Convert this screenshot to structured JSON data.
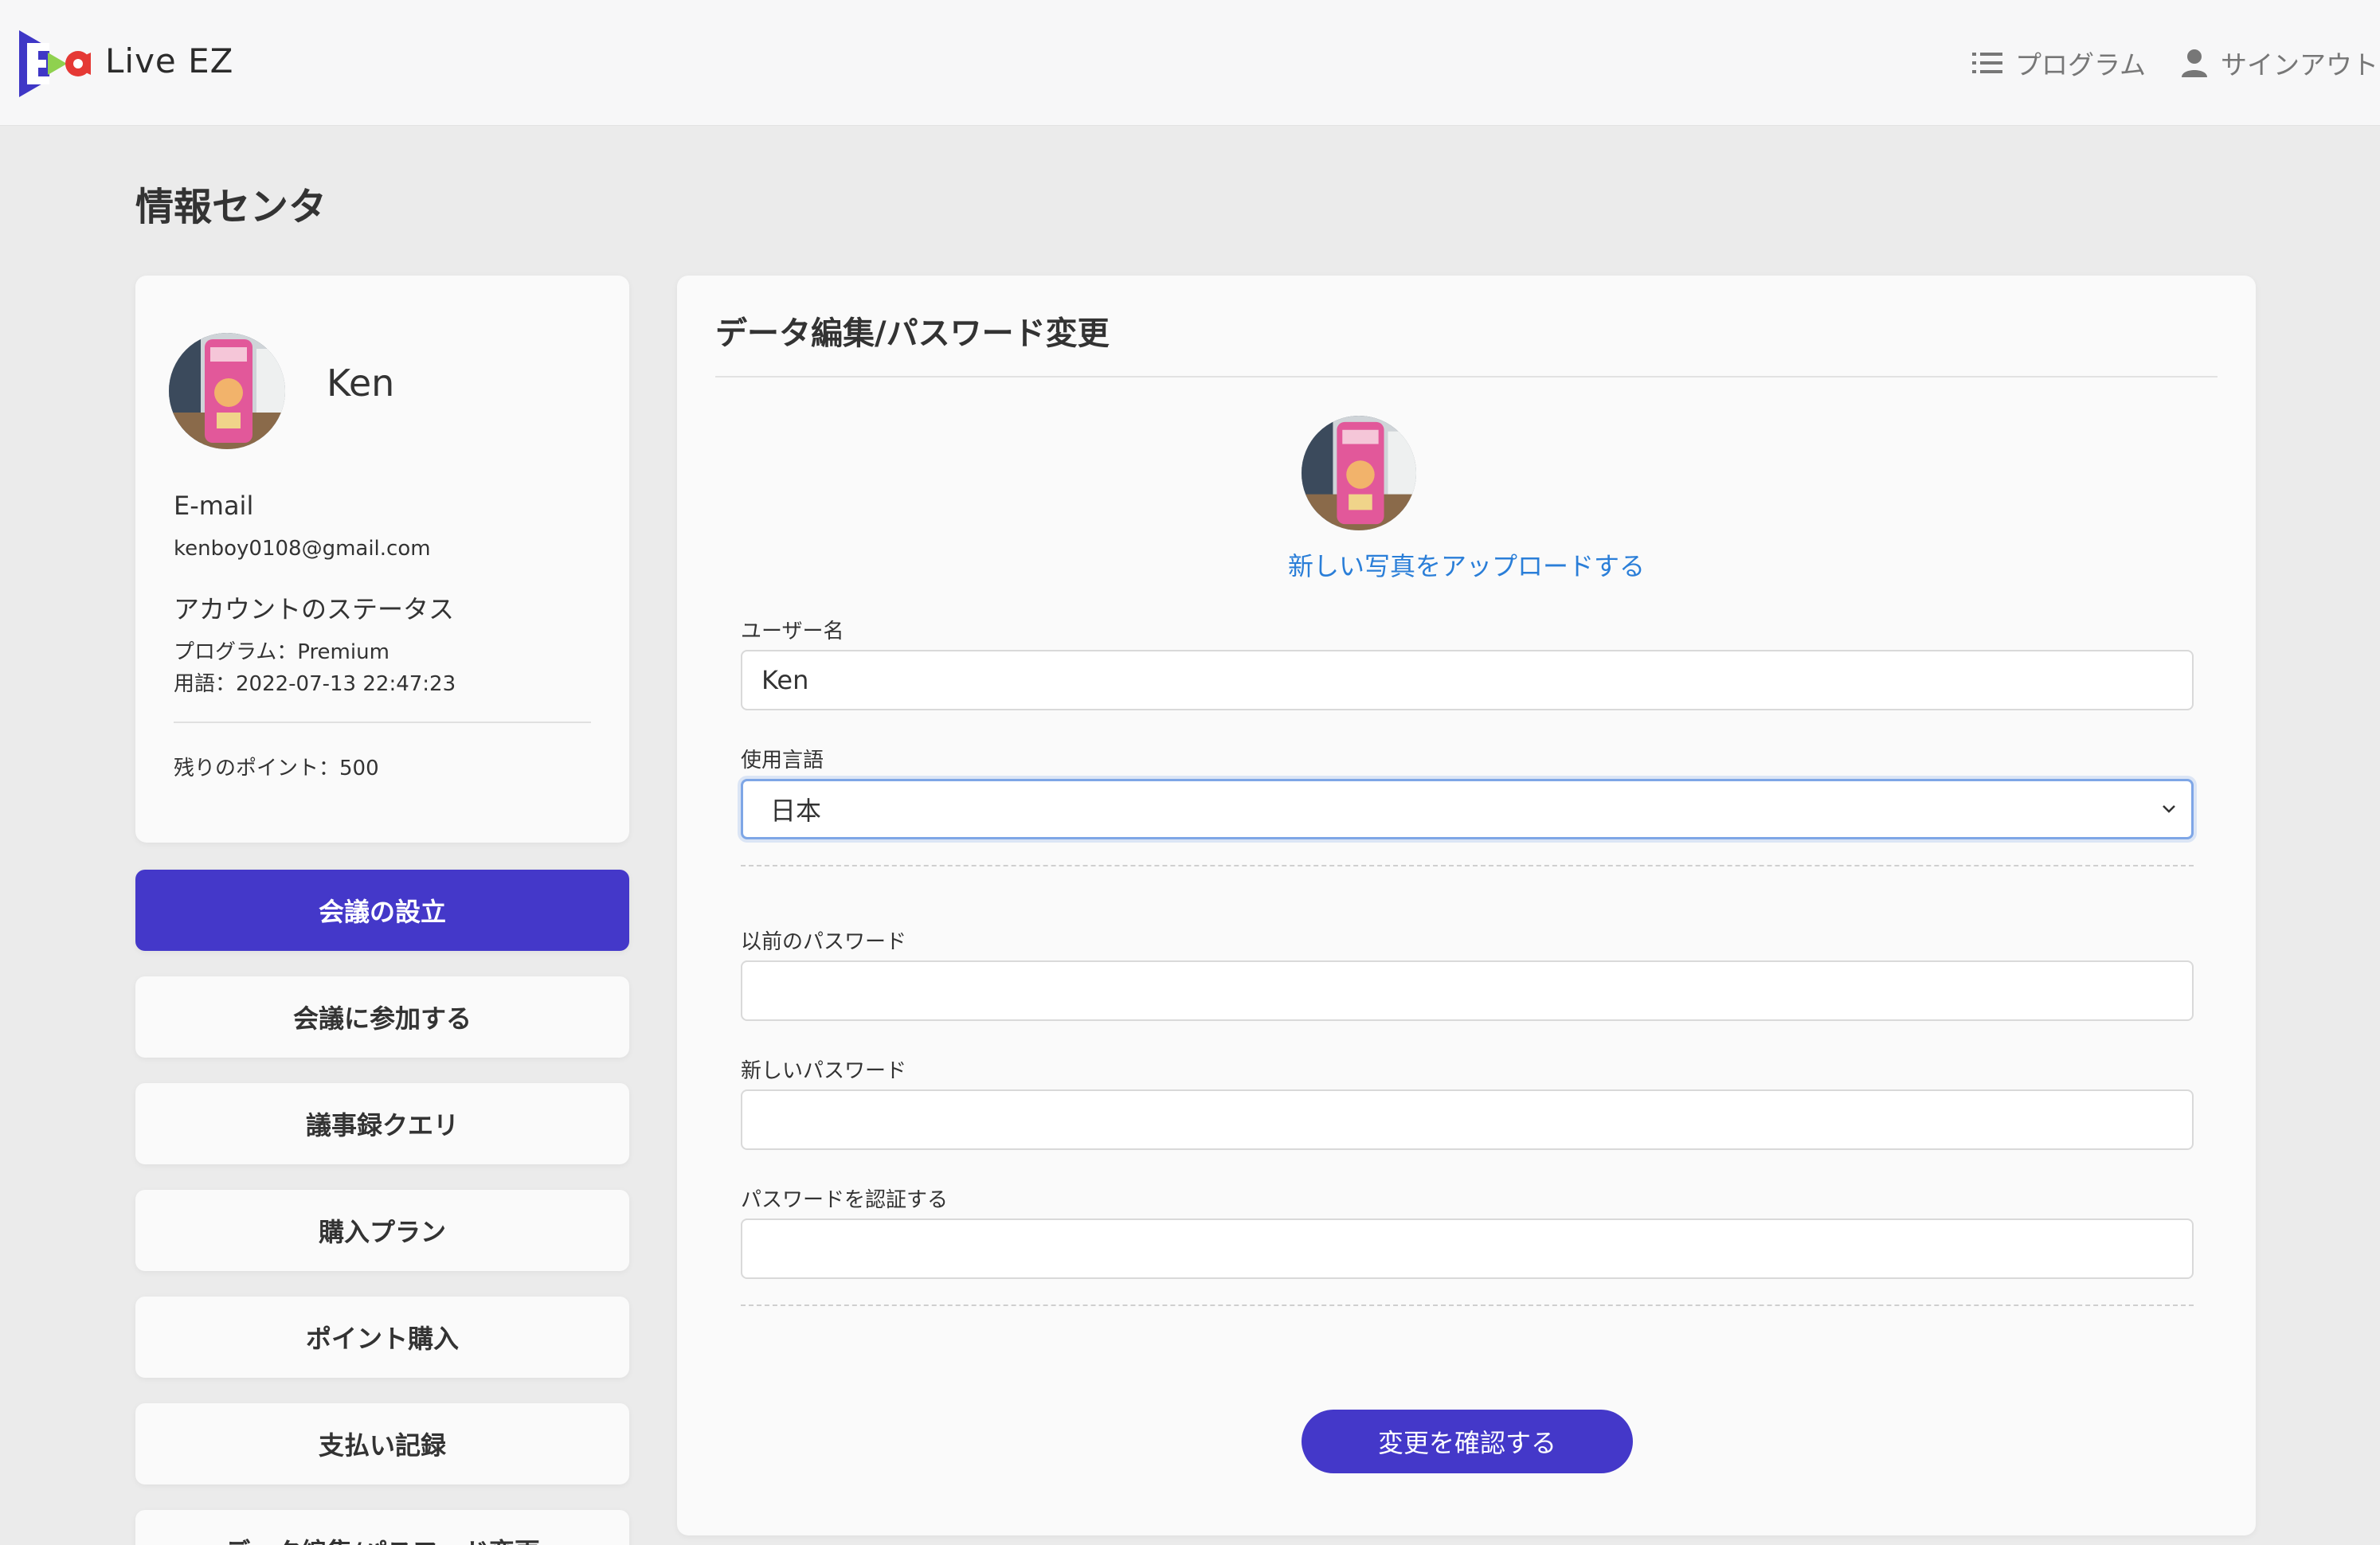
{
  "header": {
    "brand": "Live EZ",
    "nav": {
      "program_label": "プログラム",
      "signout_label": "サインアウト"
    }
  },
  "page": {
    "title": "情報センタ"
  },
  "profile": {
    "name": "Ken",
    "email_label": "E-mail",
    "email": "kenboy0108@gmail.com",
    "status_label": "アカウントのステータス",
    "program_line": "プログラム：Premium",
    "term_line": "用語：2022-07-13 22:47:23",
    "points_line": "残りのポイント：500"
  },
  "menu": {
    "items": [
      {
        "label": "会議の設立",
        "active": true
      },
      {
        "label": "会議に参加する",
        "active": false
      },
      {
        "label": "議事録クエリ",
        "active": false
      },
      {
        "label": "購入プラン",
        "active": false
      },
      {
        "label": "ポイント購入",
        "active": false
      },
      {
        "label": "支払い記録",
        "active": false
      },
      {
        "label": "データ編集/パスワード変更",
        "active": false
      }
    ]
  },
  "form": {
    "title": "データ編集/パスワード変更",
    "upload_link": "新しい写真をアップロードする",
    "username_label": "ユーザー名",
    "username_value": "Ken",
    "language_label": "使用言語",
    "language_value": "日本",
    "old_password_label": "以前のパスワード",
    "new_password_label": "新しいパスワード",
    "confirm_password_label": "パスワードを認証する",
    "submit_label": "変更を確認する"
  },
  "colors": {
    "accent": "#4438c9",
    "link": "#2a7ed8",
    "background": "#ebebeb",
    "card": "#fafafa"
  },
  "icons": {
    "nav_program": "list-icon",
    "nav_signout": "user-icon",
    "select_arrow": "chevron-down-icon"
  }
}
